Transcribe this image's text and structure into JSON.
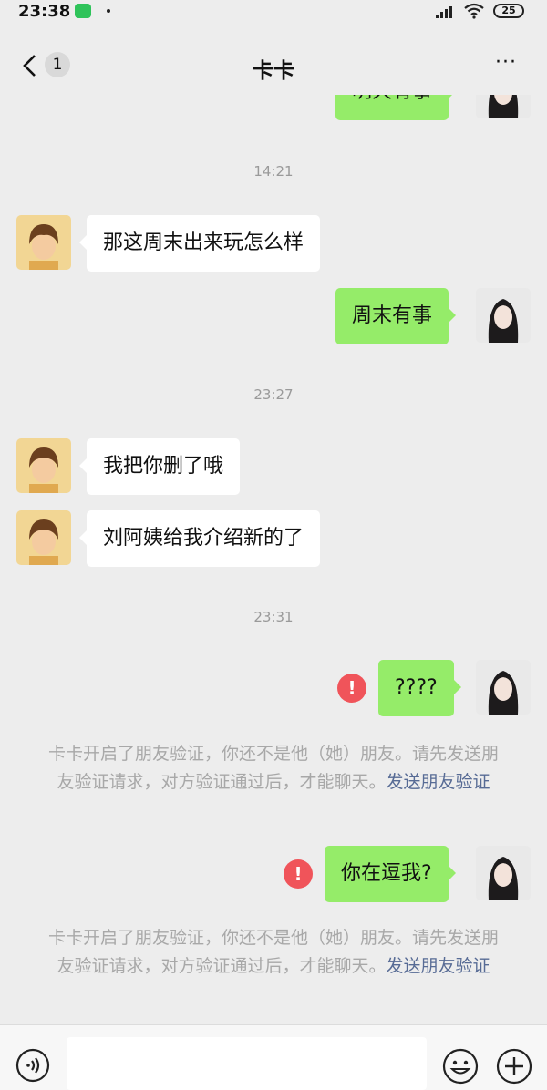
{
  "status": {
    "time": "23:38",
    "battery": "25"
  },
  "header": {
    "back_badge": "1",
    "title": "卡卡",
    "more": "···"
  },
  "chat": {
    "top_partial": "明天有事",
    "ts1": "14:21",
    "m1": "那这周末出来玩怎么样",
    "m2": "周末有事",
    "ts2": "23:27",
    "m3": "我把你删了哦",
    "m4": "刘阿姨给我介绍新的了",
    "ts3": "23:31",
    "m5": "????",
    "m6": "你在逗我?",
    "error_mark": "!",
    "notice": {
      "text": "卡卡开启了朋友验证，你还不是他（她）朋友。请先发送朋友验证请求，对方验证通过后，才能聊天。",
      "link": "发送朋友验证"
    }
  },
  "colors": {
    "outgoing_bubble": "#95ec69",
    "incoming_bubble": "#ffffff",
    "link": "#576b95",
    "error": "#f0545a"
  }
}
